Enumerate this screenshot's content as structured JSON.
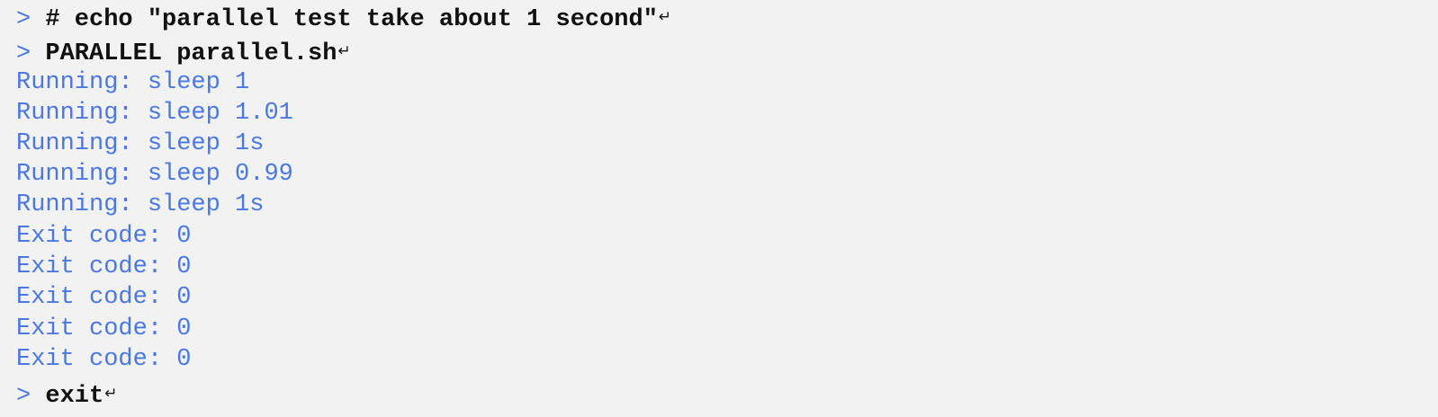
{
  "terminal": {
    "prompt_symbol": ">",
    "return_symbol": "↵",
    "lines": [
      {
        "kind": "command",
        "text": "# echo \"parallel test take about 1 second\""
      },
      {
        "kind": "command",
        "text": "PARALLEL parallel.sh"
      },
      {
        "kind": "output",
        "text": "Running: sleep 1"
      },
      {
        "kind": "output",
        "text": "Running: sleep 1.01"
      },
      {
        "kind": "output",
        "text": "Running: sleep 1s"
      },
      {
        "kind": "output",
        "text": "Running: sleep 0.99"
      },
      {
        "kind": "output",
        "text": "Running: sleep 1s"
      },
      {
        "kind": "output",
        "text": "Exit code: 0"
      },
      {
        "kind": "output",
        "text": "Exit code: 0"
      },
      {
        "kind": "output",
        "text": "Exit code: 0"
      },
      {
        "kind": "output",
        "text": "Exit code: 0"
      },
      {
        "kind": "output",
        "text": "Exit code: 0"
      },
      {
        "kind": "command",
        "text": "exit"
      }
    ]
  },
  "colors": {
    "background": "#f2f2f2",
    "output_text": "#4a78e0",
    "command_text": "#111111"
  }
}
